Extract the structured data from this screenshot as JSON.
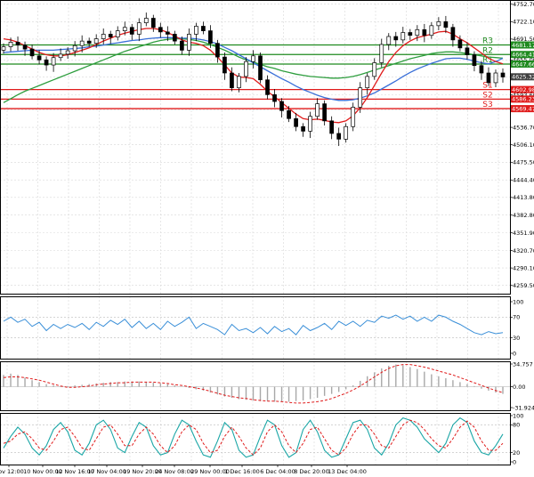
{
  "chart_data": {
    "type": "candlestick",
    "price_panel": {
      "ylim": [
        4245,
        4760
      ],
      "y_ticks": [
        "4752.70",
        "4722.10",
        "4691.50",
        "4655.00",
        "4625.32",
        "4593.60",
        "4567.10",
        "4536.70",
        "4506.10",
        "4475.50",
        "4444.40",
        "4413.80",
        "4382.80",
        "4351.90",
        "4320.70",
        "4290.10",
        "4259.50"
      ],
      "y_tick_values": [
        4752.7,
        4722.1,
        4691.5,
        4655.0,
        4625.32,
        4593.6,
        4567.1,
        4536.7,
        4506.1,
        4475.5,
        4444.4,
        4413.8,
        4382.8,
        4351.9,
        4320.7,
        4290.1,
        4259.5
      ],
      "current_price": "4625.32",
      "current_price_value": 4625.32,
      "levels": [
        {
          "name": "R3",
          "value": 4681.17,
          "label": "4681.17",
          "color": "#1f8a1f"
        },
        {
          "name": "R2",
          "value": 4664.41,
          "label": "4664.41",
          "color": "#1f8a1f"
        },
        {
          "name": "R1",
          "value": 4647.66,
          "label": "4647.66",
          "color": "#1f8a1f"
        },
        {
          "name": "S1",
          "value": 4602.98,
          "label": "4602.98",
          "color": "#e01b1b"
        },
        {
          "name": "S2",
          "value": 4586.23,
          "label": "4586.23",
          "color": "#e01b1b"
        },
        {
          "name": "S3",
          "value": 4569.47,
          "label": "4569.47",
          "color": "#e01b1b"
        }
      ],
      "candles_close": [
        4678,
        4686,
        4681,
        4674,
        4662,
        4655,
        4646,
        4659,
        4665,
        4671,
        4680,
        4688,
        4684,
        4692,
        4700,
        4695,
        4706,
        4712,
        4700,
        4720,
        4728,
        4712,
        4704,
        4700,
        4688,
        4672,
        4700,
        4714,
        4706,
        4684,
        4660,
        4632,
        4606,
        4626,
        4652,
        4662,
        4620,
        4594,
        4582,
        4566,
        4552,
        4538,
        4530,
        4556,
        4578,
        4548,
        4526,
        4516,
        4538,
        4572,
        4606,
        4626,
        4650,
        4682,
        4696,
        4690,
        4703,
        4698,
        4708,
        4698,
        4715,
        4722,
        4712,
        4690,
        4676,
        4664,
        4645,
        4632,
        4615,
        4632,
        4625
      ],
      "ma_fast": [
        4692,
        4690,
        4686,
        4680,
        4674,
        4668,
        4664,
        4662,
        4662,
        4664,
        4668,
        4672,
        4676,
        4682,
        4688,
        4693,
        4698,
        4702,
        4705,
        4708,
        4710,
        4710,
        4708,
        4703,
        4697,
        4690,
        4686,
        4684,
        4680,
        4672,
        4660,
        4646,
        4632,
        4625,
        4624,
        4622,
        4612,
        4600,
        4590,
        4580,
        4570,
        4560,
        4552,
        4550,
        4551,
        4549,
        4546,
        4545,
        4548,
        4557,
        4571,
        4589,
        4610,
        4632,
        4652,
        4668,
        4680,
        4688,
        4694,
        4697,
        4700,
        4704,
        4705,
        4700,
        4692,
        4685,
        4676,
        4667,
        4658,
        4652,
        4648
      ],
      "ma_mid": [
        4668,
        4669,
        4670,
        4671,
        4672,
        4672,
        4672,
        4672,
        4673,
        4674,
        4675,
        4676,
        4678,
        4679,
        4681,
        4683,
        4685,
        4687,
        4689,
        4690,
        4692,
        4693,
        4694,
        4694,
        4694,
        4693,
        4693,
        4692,
        4690,
        4687,
        4683,
        4677,
        4671,
        4664,
        4657,
        4650,
        4643,
        4636,
        4629,
        4622,
        4616,
        4609,
        4603,
        4598,
        4593,
        4589,
        4586,
        4584,
        4584,
        4585,
        4588,
        4592,
        4597,
        4604,
        4611,
        4618,
        4626,
        4633,
        4639,
        4644,
        4649,
        4653,
        4657,
        4658,
        4658,
        4656,
        4653,
        4650,
        4648,
        4652,
        4658
      ],
      "ma_slow": [
        4580,
        4587,
        4594,
        4600,
        4605,
        4610,
        4615,
        4620,
        4625,
        4630,
        4635,
        4640,
        4645,
        4650,
        4655,
        4660,
        4665,
        4670,
        4674,
        4678,
        4682,
        4686,
        4689,
        4691,
        4692,
        4692,
        4691,
        4689,
        4686,
        4682,
        4677,
        4672,
        4666,
        4660,
        4655,
        4651,
        4647,
        4643,
        4640,
        4636,
        4633,
        4630,
        4628,
        4626,
        4625,
        4624,
        4623,
        4623,
        4624,
        4626,
        4629,
        4633,
        4637,
        4641,
        4645,
        4649,
        4653,
        4657,
        4660,
        4663,
        4666,
        4668,
        4669,
        4669,
        4668,
        4666,
        4664,
        4662,
        4660,
        4659,
        4658
      ]
    },
    "rsi_panel": {
      "ylim": [
        0,
        100
      ],
      "y_ticks": [
        "100",
        "70",
        "30",
        "0"
      ],
      "y_tick_values": [
        100,
        70,
        30,
        0
      ],
      "values": [
        62,
        70,
        60,
        66,
        52,
        60,
        44,
        56,
        48,
        56,
        50,
        58,
        46,
        60,
        52,
        64,
        56,
        66,
        50,
        62,
        48,
        58,
        46,
        62,
        52,
        60,
        70,
        48,
        58,
        52,
        46,
        36,
        56,
        44,
        48,
        40,
        50,
        38,
        52,
        42,
        48,
        36,
        54,
        44,
        50,
        58,
        46,
        62,
        54,
        62,
        52,
        64,
        60,
        72,
        68,
        74,
        66,
        72,
        62,
        70,
        62,
        74,
        70,
        62,
        56,
        48,
        40,
        36,
        42,
        38,
        40
      ]
    },
    "macd_panel": {
      "ylim": [
        -31.924,
        34.757
      ],
      "y_ticks": [
        "34.757",
        "0.00",
        "-31.924"
      ],
      "y_tick_values": [
        34.757,
        0,
        -31.924
      ],
      "histogram": [
        18,
        20,
        18,
        14,
        10,
        7,
        4,
        2,
        1,
        1,
        2,
        3,
        4,
        5,
        6,
        7,
        7,
        8,
        8,
        8,
        7,
        6,
        5,
        4,
        2,
        0,
        -2,
        -4,
        -6,
        -9,
        -12,
        -15,
        -17,
        -19,
        -20,
        -21,
        -22,
        -22,
        -23,
        -23,
        -23,
        -22,
        -21,
        -19,
        -17,
        -14,
        -11,
        -8,
        -4,
        2,
        9,
        16,
        22,
        28,
        32,
        34,
        33,
        30,
        27,
        23,
        19,
        16,
        13,
        10,
        7,
        4,
        1,
        -3,
        -6,
        -9,
        -11
      ],
      "signal": [
        14,
        15,
        15,
        14,
        12,
        10,
        7,
        4,
        1,
        -1,
        -1,
        0,
        1,
        3,
        4,
        5,
        6,
        6,
        7,
        7,
        7,
        7,
        6,
        5,
        3,
        2,
        0,
        -2,
        -4,
        -7,
        -10,
        -13,
        -15,
        -17,
        -18,
        -20,
        -21,
        -22,
        -22,
        -23,
        -24,
        -25,
        -25,
        -24,
        -23,
        -21,
        -18,
        -14,
        -10,
        -5,
        1,
        8,
        15,
        22,
        28,
        32,
        34,
        34,
        32,
        30,
        27,
        24,
        21,
        18,
        14,
        10,
        6,
        2,
        -2,
        -6,
        -9
      ]
    },
    "stoch_panel": {
      "ylim": [
        0,
        100
      ],
      "y_ticks": [
        "100",
        "80",
        "20",
        "0"
      ],
      "y_tick_values": [
        100,
        80,
        20,
        0
      ],
      "k": [
        30,
        55,
        75,
        60,
        30,
        15,
        35,
        70,
        85,
        65,
        25,
        15,
        40,
        80,
        90,
        70,
        30,
        20,
        55,
        85,
        75,
        35,
        15,
        20,
        60,
        90,
        80,
        45,
        15,
        10,
        45,
        85,
        70,
        25,
        10,
        15,
        55,
        90,
        80,
        35,
        10,
        20,
        70,
        90,
        65,
        25,
        10,
        15,
        50,
        85,
        90,
        70,
        30,
        15,
        40,
        80,
        95,
        90,
        75,
        50,
        35,
        20,
        40,
        80,
        95,
        85,
        45,
        20,
        15,
        35,
        60
      ],
      "d": [
        40,
        45,
        60,
        65,
        50,
        30,
        25,
        45,
        70,
        75,
        55,
        30,
        25,
        50,
        75,
        80,
        60,
        35,
        35,
        60,
        75,
        60,
        35,
        20,
        35,
        65,
        80,
        70,
        40,
        20,
        25,
        55,
        75,
        55,
        30,
        15,
        30,
        65,
        80,
        65,
        35,
        20,
        40,
        70,
        75,
        50,
        25,
        15,
        30,
        60,
        80,
        80,
        60,
        35,
        30,
        55,
        80,
        90,
        85,
        70,
        50,
        35,
        30,
        50,
        75,
        88,
        75,
        45,
        25,
        25,
        40
      ]
    },
    "x_ticks": [
      "Nov 12:00",
      "10 Nov 00:00",
      "12 Nov 16:00",
      "17 Nov 04:00",
      "19 Nov 20:00",
      "24 Nov 08:00",
      "29 Nov 00:00",
      "1 Dec 16:00",
      "6 Dec 04:00",
      "8 Dec 20:00",
      "13 Dec 04:00"
    ],
    "colors": {
      "ma_fast": "#e01b1b",
      "ma_mid": "#3a6fd8",
      "ma_slow": "#2e9e3e",
      "rsi": "#3a8fd8",
      "macd_signal": "#e01b1b",
      "stoch_k": "#1aa6a6",
      "stoch_d": "#e01b1b",
      "price_badge": "#404040"
    }
  }
}
